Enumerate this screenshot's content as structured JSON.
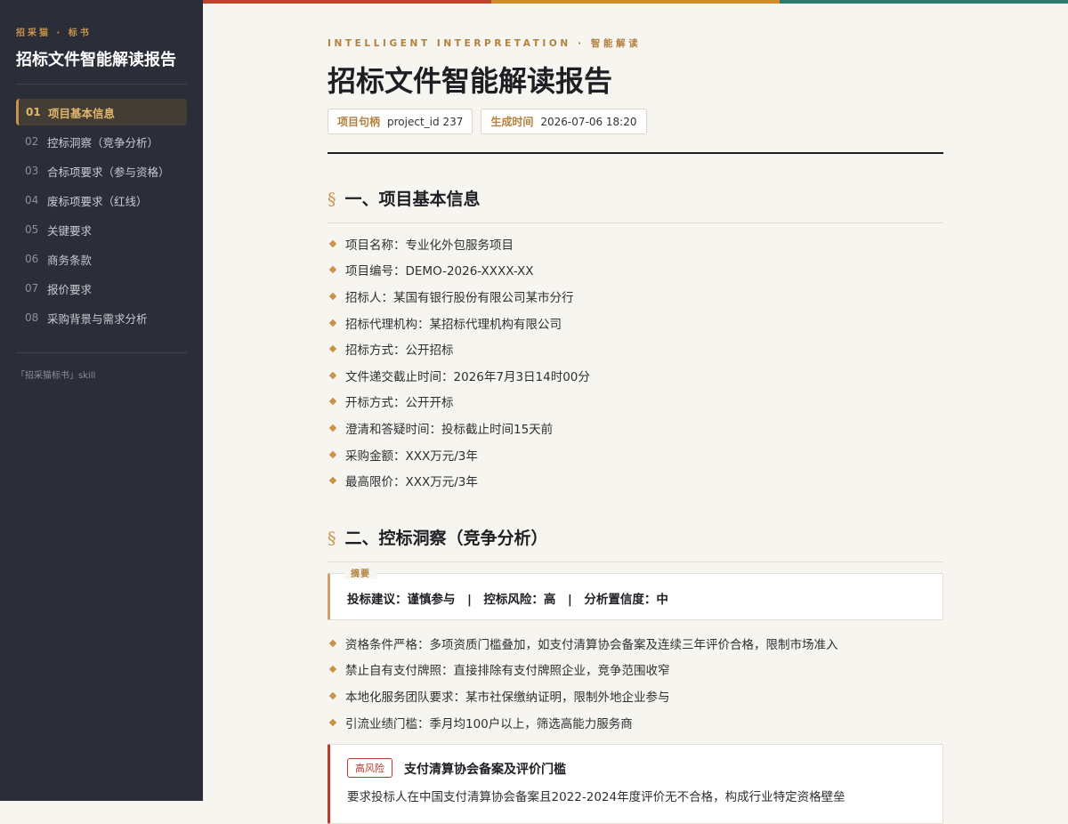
{
  "sidebar": {
    "brand": "招采猫 · 标书",
    "title": "招标文件智能解读报告",
    "items": [
      {
        "num": "01",
        "label": "项目基本信息"
      },
      {
        "num": "02",
        "label": "控标洞察（竞争分析）"
      },
      {
        "num": "03",
        "label": "合标项要求（参与资格）"
      },
      {
        "num": "04",
        "label": "废标项要求（红线）"
      },
      {
        "num": "05",
        "label": "关键要求"
      },
      {
        "num": "06",
        "label": "商务条款"
      },
      {
        "num": "07",
        "label": "报价要求"
      },
      {
        "num": "08",
        "label": "采购背景与需求分析"
      }
    ],
    "active_index": 0,
    "footer": "「招采猫标书」skill"
  },
  "colors": {
    "topbar": [
      "#c0432f",
      "#d48b2a",
      "#2f7a6c"
    ],
    "accent": "#c9944a",
    "risk": "#b83a2d"
  },
  "header": {
    "eyebrow": "INTELLIGENT INTERPRETATION · 智能解读",
    "title": "招标文件智能解读报告",
    "meta": [
      {
        "key": "项目句柄",
        "value": "project_id 237"
      },
      {
        "key": "生成时间",
        "value": "2026-07-06 18:20"
      }
    ]
  },
  "section1": {
    "mark": "§",
    "title": "一、项目基本信息",
    "items": [
      "项目名称：专业化外包服务项目",
      "项目编号：DEMO-2026-XXXX-XX",
      "招标人：某国有银行股份有限公司某市分行",
      "招标代理机构：某招标代理机构有限公司",
      "招标方式：公开招标",
      "文件递交截止时间：2026年7月3日14时00分",
      "开标方式：公开开标",
      "澄清和答疑时间：投标截止时间15天前",
      "采购金额：XXX万元/3年",
      "最高限价：XXX万元/3年"
    ]
  },
  "section2": {
    "mark": "§",
    "title": "二、控标洞察（竞争分析）",
    "summary_tag": "摘要",
    "summary": "投标建议：谨慎参与　|　控标风险：高　|　分析置信度：中",
    "items": [
      "资格条件严格：多项资质门槛叠加，如支付清算协会备案及连续三年评价合格，限制市场准入",
      "禁止自有支付牌照：直接排除有支付牌照企业，竞争范围收窄",
      "本地化服务团队要求：某市社保缴纳证明，限制外地企业参与",
      "引流业绩门槛：季月均100户以上，筛选高能力服务商"
    ],
    "risk": {
      "badge": "高风险",
      "title": "支付清算协会备案及评价门槛",
      "desc": "要求投标人在中国支付清算协会备案且2022-2024年度评价无不合格，构成行业特定资格壁垒"
    }
  }
}
